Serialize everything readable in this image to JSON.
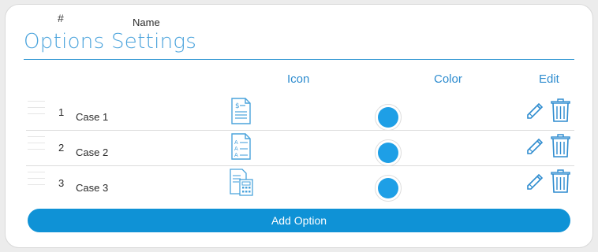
{
  "panel": {
    "title": "Options Settings"
  },
  "table": {
    "headers": {
      "num": "#",
      "name": "Name",
      "icon": "Icon",
      "color": "Color",
      "edit": "Edit"
    },
    "rows": [
      {
        "num": "1",
        "name": "Case 1",
        "icon": "dollar-document-icon",
        "color": "#1e9fe6"
      },
      {
        "num": "2",
        "name": "Case 2",
        "icon": "answer-sheet-icon",
        "color": "#1e9fe6"
      },
      {
        "num": "3",
        "name": "Case 3",
        "icon": "calculator-document-icon",
        "color": "#1e9fe6"
      }
    ]
  },
  "actions": {
    "add_label": "Add Option"
  },
  "colors": {
    "accent": "#0f92d6",
    "header_text": "#2e8ccf",
    "icon_stroke": "#4aa3dc",
    "swatch": "#1e9fe6"
  }
}
